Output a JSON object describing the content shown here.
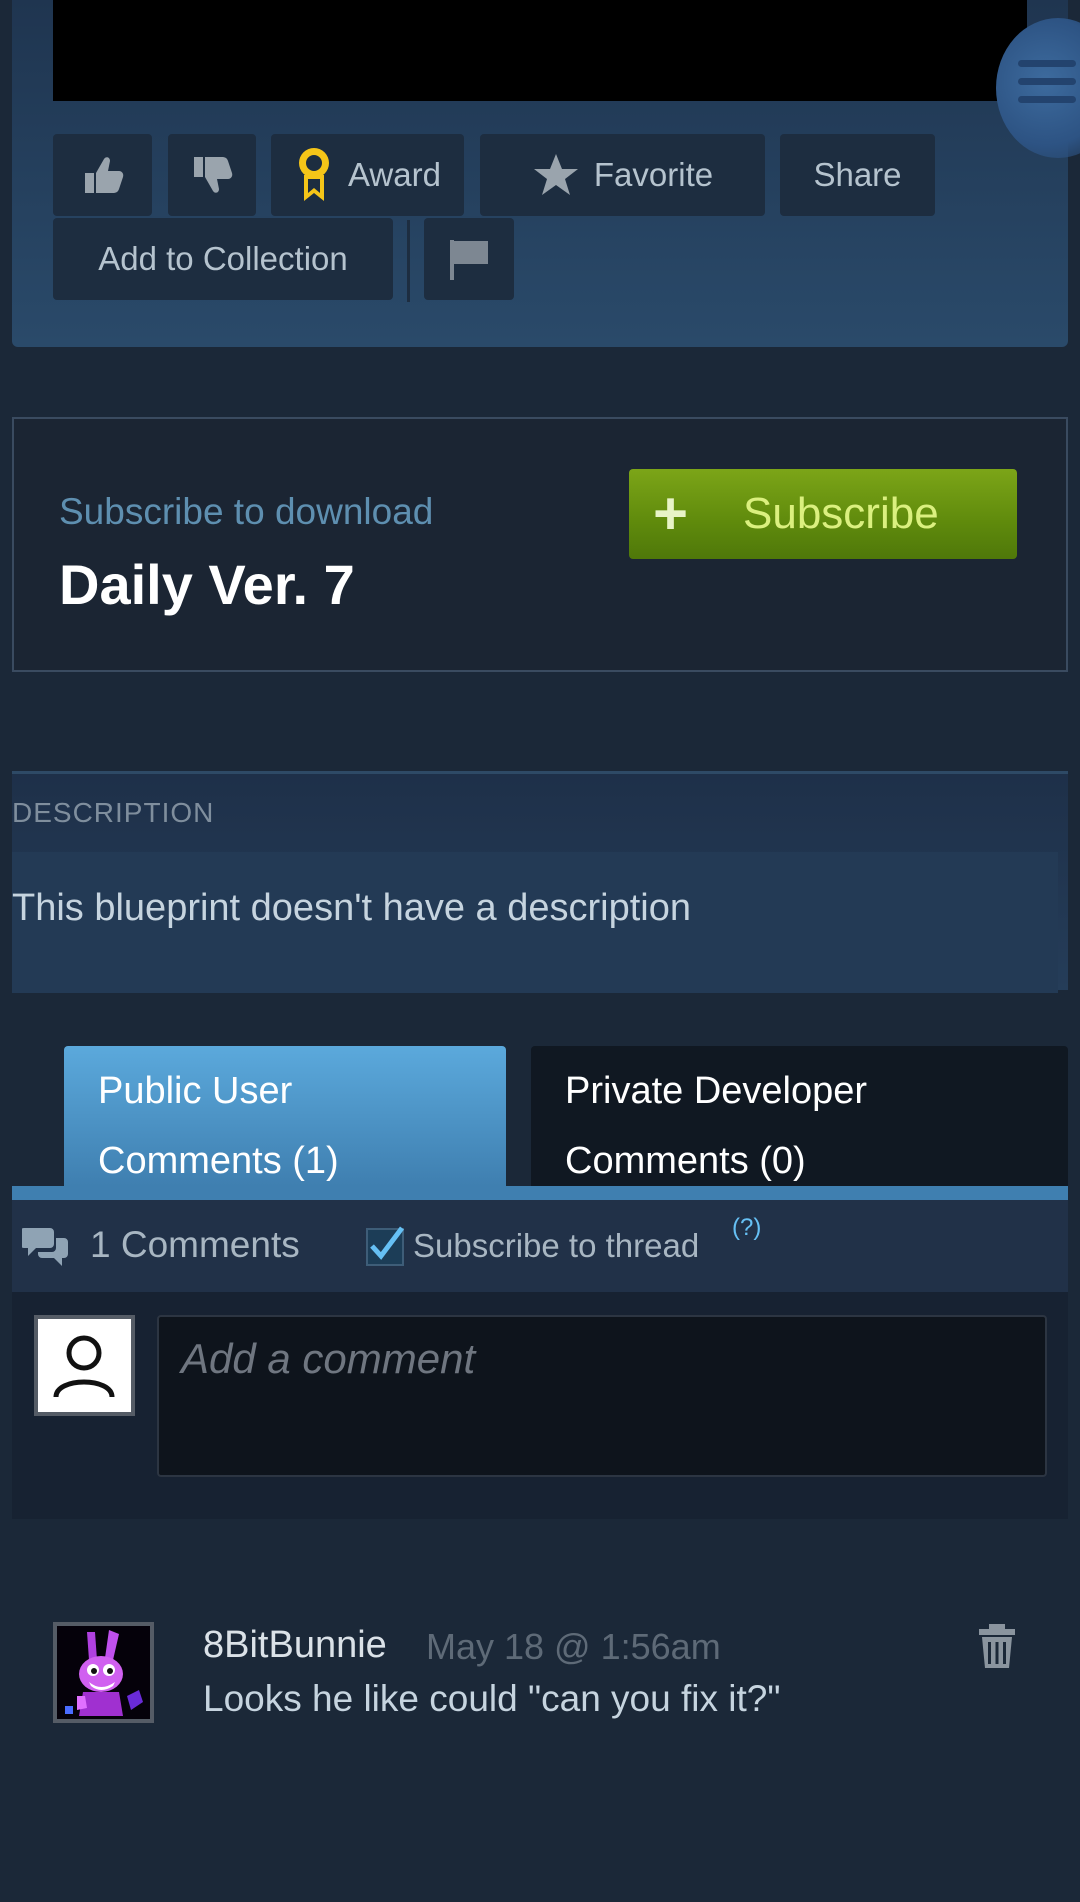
{
  "actions": {
    "thumbs_up_icon": "thumbs-up-icon",
    "thumbs_down_icon": "thumbs-down-icon",
    "award_label": "Award",
    "favorite_label": "Favorite",
    "share_label": "Share",
    "add_to_collection_label": "Add to Collection",
    "flag_icon": "flag-icon"
  },
  "subscribe": {
    "label": "Subscribe to download",
    "title": "Daily Ver. 7",
    "button_label": "Subscribe"
  },
  "description": {
    "header": "DESCRIPTION",
    "text": "This blueprint doesn't have a description"
  },
  "tabs": [
    {
      "line1": "Public User",
      "line2": "Comments (1)",
      "active": true
    },
    {
      "line1": "Private Developer",
      "line2": "Comments (0)",
      "active": false
    }
  ],
  "comments": {
    "count_label": "1 Comments",
    "subscribe_thread_label": "Subscribe to thread",
    "subscribe_thread_checked": true,
    "help_label": "(?)",
    "input_placeholder": "Add a comment",
    "items": [
      {
        "author": "8BitBunnie",
        "timestamp": "May 18 @ 1:56am",
        "text": "Looks he like could \"can you fix it?\""
      }
    ]
  },
  "colors": {
    "background": "#1b2838",
    "subscribe_green": "#75a015",
    "tab_active_blue": "#4f93c9",
    "link_blue": "#66c0f4",
    "award_gold": "#f5c518"
  }
}
